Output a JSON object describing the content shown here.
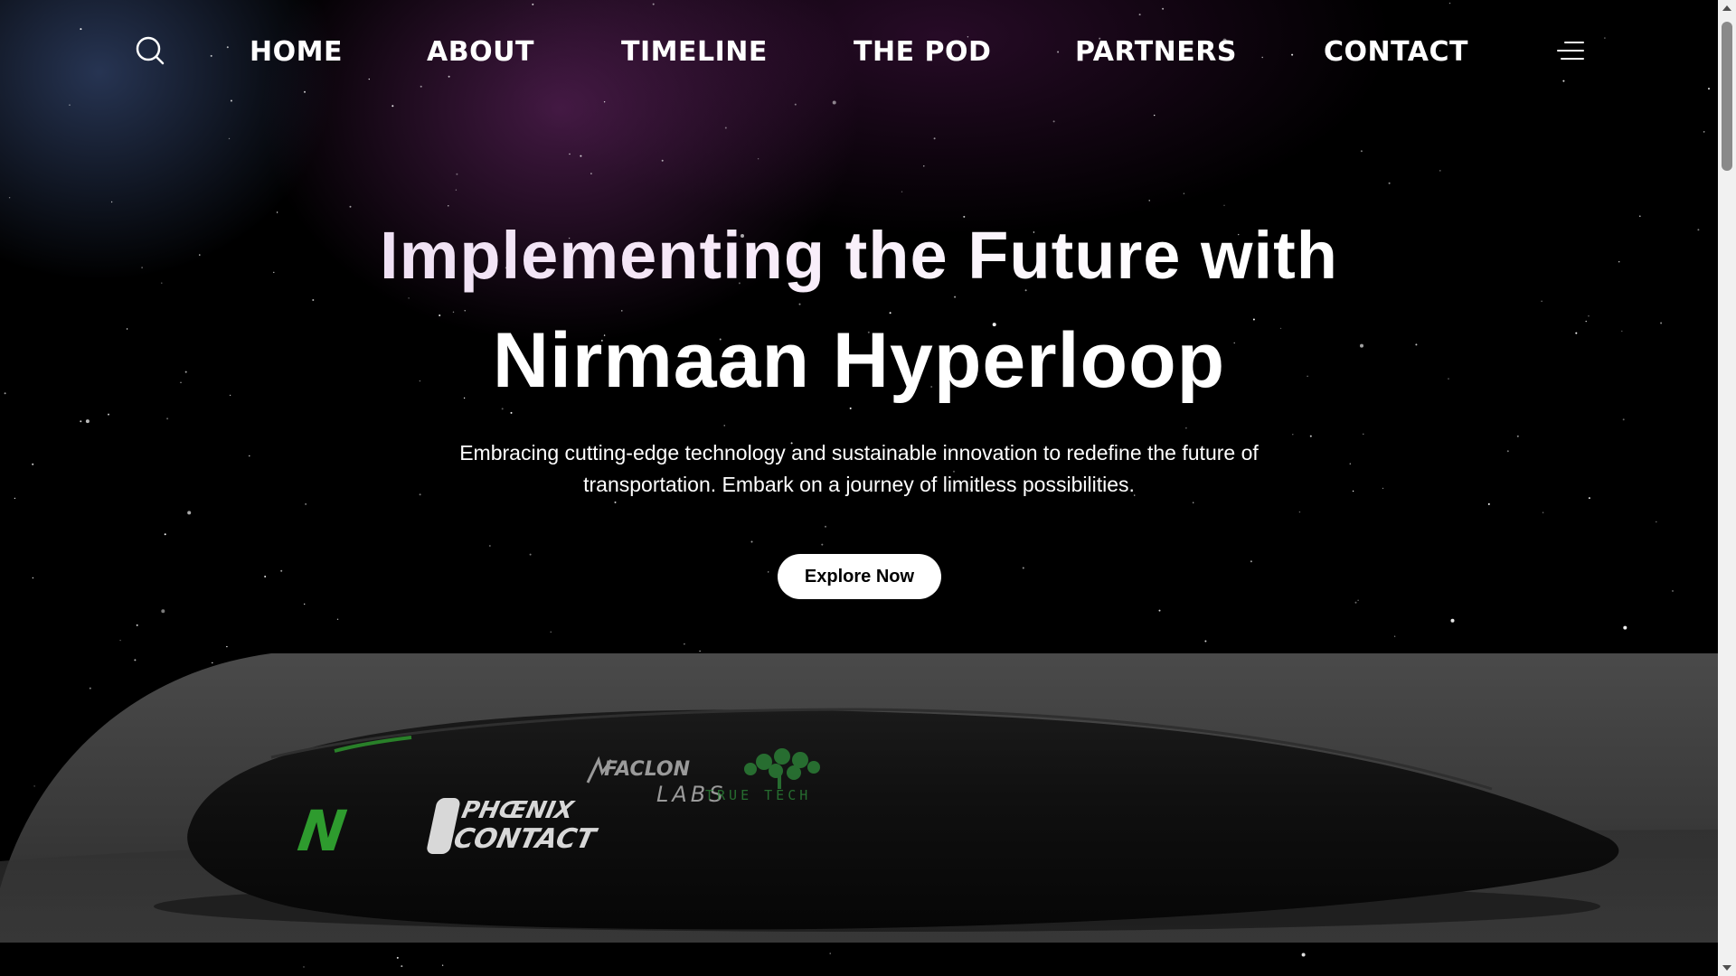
{
  "nav": {
    "items": [
      {
        "label": "HOME"
      },
      {
        "label": "ABOUT"
      },
      {
        "label": "TIMELINE"
      },
      {
        "label": "THE POD"
      },
      {
        "label": "PARTNERS"
      },
      {
        "label": "CONTACT"
      }
    ],
    "search_icon": "search-icon",
    "menu_icon": "menu-icon"
  },
  "hero": {
    "title_line1": "Implementing the Future with",
    "title_line2": "Nirmaan Hyperloop",
    "subtitle": "Embracing cutting-edge technology and sustainable innovation to redefine the future of transportation. Embark on a journey of limitless possibilities.",
    "cta_label": "Explore Now"
  },
  "pod": {
    "logos": {
      "n_mark": "N",
      "phoenix_line1": "PHŒNIX",
      "phoenix_line2": "CONTACT",
      "faclon_line1": "FACLON",
      "faclon_line2": "LABS",
      "truetech": "TRUE TECH"
    },
    "accent_green": "#2e9b2e"
  },
  "colors": {
    "background": "#000000",
    "text": "#ffffff",
    "button_bg": "#ffffff",
    "button_text": "#000000"
  }
}
